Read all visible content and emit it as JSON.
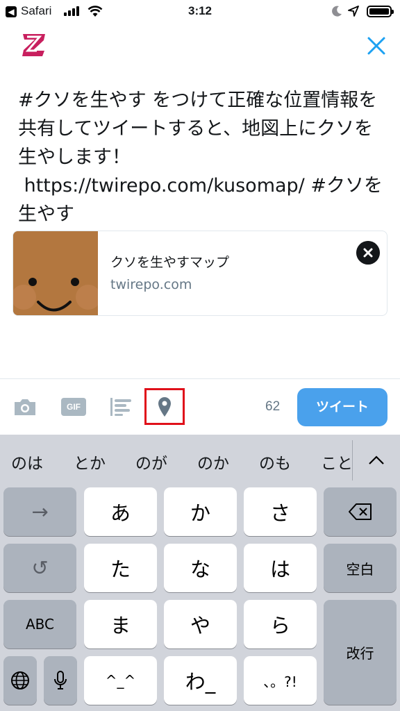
{
  "status_bar": {
    "back_glyph": "◀",
    "app": "Safari",
    "time": "3:12"
  },
  "header": {
    "logo_icon": "zenback-logo-icon",
    "close_icon": "close-icon"
  },
  "tweet": {
    "text": "#クソを生やす をつけて正確な位置情報を共有してツイートすると、地図上にクソを生やします！\n https://twirepo.com/kusomap/ #クソを生やす"
  },
  "link_card": {
    "title": "クソを生やすマップ",
    "domain": "twirepo.com"
  },
  "toolbar": {
    "gif_label": "GIF",
    "char_count": "62",
    "tweet_label": "ツイート",
    "highlight_color": "#e0101a",
    "accent_color": "#4aa1ec"
  },
  "keyboard": {
    "suggestions": [
      "のは",
      "とか",
      "のが",
      "のか",
      "のも",
      "こと"
    ],
    "keys": {
      "a": "あ",
      "ka": "か",
      "sa": "さ",
      "ta": "た",
      "na": "な",
      "ha": "は",
      "ma": "ま",
      "ya": "や",
      "ra": "ら",
      "kaomoji": "^_^",
      "wa": "わ_",
      "punct": "、。?!",
      "abc": "ABC",
      "space": "空白",
      "enter": "改行",
      "next": "→",
      "undo": "↺"
    }
  }
}
